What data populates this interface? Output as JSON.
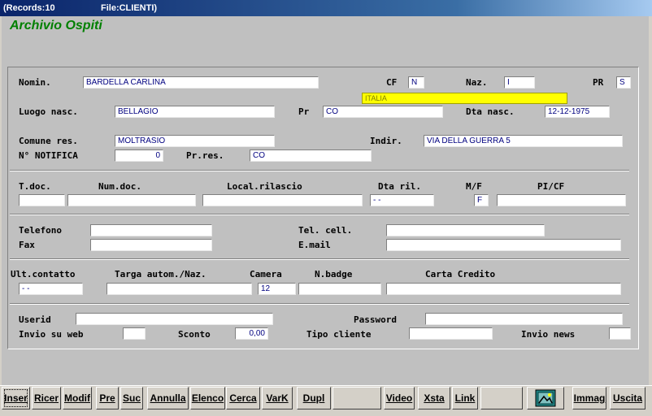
{
  "title": {
    "records": "(Records:10",
    "file": "File:CLIENTI)"
  },
  "heading": "Archivio Ospiti",
  "labels": {
    "nomin": "Nomin.",
    "cf": "CF",
    "naz": "Naz.",
    "pr": "PR",
    "luogo": "Luogo nasc.",
    "pr2": "Pr",
    "dta_nasc": "Dta nasc.",
    "comune": "Comune res.",
    "indir": "Indir.",
    "notifica": "N° NOTIFICA",
    "prres": "Pr.res.",
    "tdoc": "T.doc.",
    "numdoc": "Num.doc.",
    "local": "Local.rilascio",
    "dtaril": "Dta ril.",
    "mf": "M/F",
    "picf": "PI/CF",
    "telefono": "Telefono",
    "telcell": "Tel. cell.",
    "fax": "Fax",
    "email": "E.mail",
    "ultcont": "Ult.contatto",
    "targa": "Targa autom./Naz.",
    "camera": "Camera",
    "nbadge": "N.badge",
    "carta": "Carta Credito",
    "userid": "Userid",
    "password": "Password",
    "inviosuweb": "Invio su web",
    "sconto": "Sconto",
    "tipocliente": "Tipo cliente",
    "invionews": "Invio news"
  },
  "values": {
    "nomin": "BARDELLA CARLINA",
    "cf": "N",
    "naz": "I",
    "pr": "S",
    "italia": "ITALIA",
    "luogo": "BELLAGIO",
    "pr2": "CO",
    "dta_nasc": "12-12-1975",
    "comune": "MOLTRASIO",
    "indir": "VIA DELLA GUERRA 5",
    "notifica": "0",
    "prres": "CO",
    "tdoc": "",
    "numdoc": "",
    "local": "",
    "dtaril": "  -  -",
    "mf": "F",
    "picf": "",
    "telefono": "",
    "telcell": "",
    "fax": "",
    "email": "",
    "ultcont": "  -  -",
    "targa": "",
    "camera": "12",
    "nbadge": "",
    "carta": "",
    "userid": "",
    "password": "",
    "inviosuweb": "",
    "sconto": "0,00",
    "tipocliente": "",
    "invionews": ""
  },
  "toolbar": {
    "inser": "Inser",
    "ricer": "Ricer",
    "modif": "Modif",
    "pre": "Pre",
    "suc": "Suc",
    "annulla": "Annulla",
    "elenco": "Elenco",
    "cerca": "Cerca",
    "vark": "VarK",
    "dupl": "Dupl",
    "video": "Video",
    "xsta": "Xsta",
    "link": "Link",
    "immag": "Immag",
    "uscita": "Uscita"
  },
  "colors": {
    "accent": "#008000",
    "field_text": "#000080",
    "highlight": "#ffff00"
  }
}
